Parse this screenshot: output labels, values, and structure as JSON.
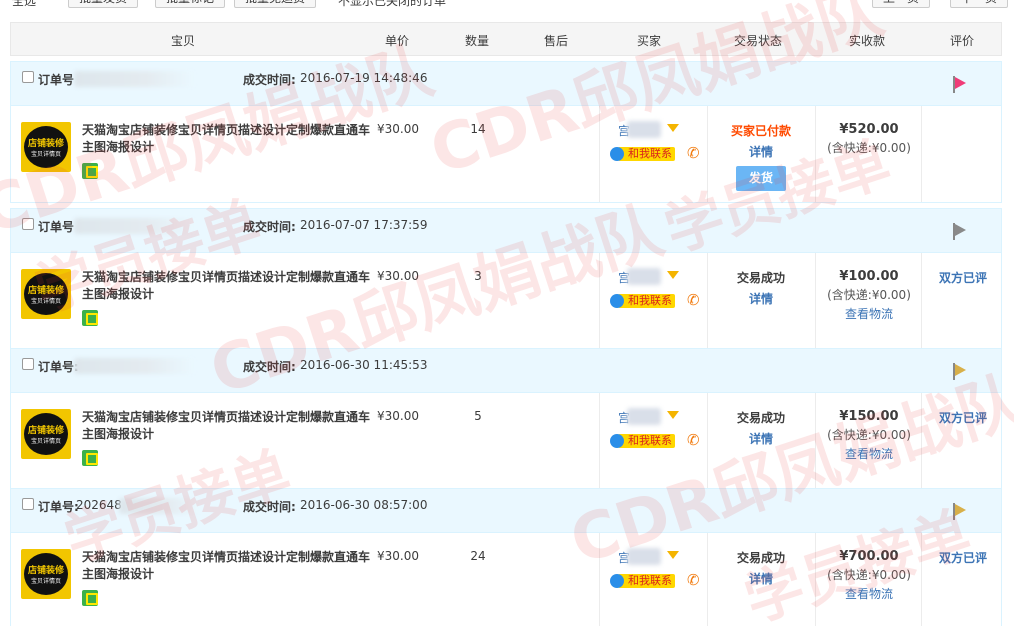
{
  "toolbar": {
    "select_all": "全选",
    "btn1": "批量发货",
    "btn2": "批量标记",
    "btn3": "批量免运费",
    "hide_closed": "不显示已关闭的订单",
    "prev": "上一页",
    "next": "下一页"
  },
  "columns": [
    "宝贝",
    "单价",
    "数量",
    "售后",
    "买家",
    "交易状态",
    "实收款",
    "评价"
  ],
  "orders": [
    {
      "order_label": "订单号",
      "order_no": "",
      "time_label": "成交时间:",
      "time": "2016-07-19 14:48:46",
      "flag_color": "#f03c78",
      "item_title": "天猫淘宝店铺装修宝贝详情页描述设计定制爆款直通车主图海报设计",
      "thumb_line1": "店铺装修",
      "thumb_line2": "宝贝详情页",
      "price": "¥30.00",
      "qty": "14",
      "buyer_name": "宫",
      "contact": "和我联系",
      "status": "买家已付款",
      "detail": "详情",
      "ship_btn": "发货",
      "amount": "¥520.00",
      "ship_fee": "(含快递:¥0.00)",
      "logistics": "",
      "review": ""
    },
    {
      "order_label": "订单号",
      "order_no": "",
      "time_label": "成交时间:",
      "time": "2016-07-07 17:37:59",
      "flag_color": "#8a8a8a",
      "item_title": "天猫淘宝店铺装修宝贝详情页描述设计定制爆款直通车主图海报设计",
      "thumb_line1": "店铺装修",
      "thumb_line2": "宝贝详情页",
      "price": "¥30.00",
      "qty": "3",
      "buyer_name": "宫",
      "contact": "和我联系",
      "status": "交易成功",
      "detail": "详情",
      "ship_btn": "",
      "amount": "¥100.00",
      "ship_fee": "(含快递:¥0.00)",
      "logistics": "查看物流",
      "review": "双方已评"
    },
    {
      "order_label": "订单号:",
      "order_no": "",
      "time_label": "成交时间:",
      "time": "2016-06-30 11:45:53",
      "flag_color": "#d8b04a",
      "item_title": "天猫淘宝店铺装修宝贝详情页描述设计定制爆款直通车主图海报设计",
      "thumb_line1": "店铺装修",
      "thumb_line2": "宝贝详情页",
      "price": "¥30.00",
      "qty": "5",
      "buyer_name": "宫",
      "contact": "和我联系",
      "status": "交易成功",
      "detail": "详情",
      "ship_btn": "",
      "amount": "¥150.00",
      "ship_fee": "(含快递:¥0.00)",
      "logistics": "查看物流",
      "review": "双方已评"
    },
    {
      "order_label": "订单号:",
      "order_no": "202648",
      "time_label": "成交时间:",
      "time": "2016-06-30 08:57:00",
      "flag_color": "#d8b04a",
      "item_title": "天猫淘宝店铺装修宝贝详情页描述设计定制爆款直通车主图海报设计",
      "thumb_line1": "店铺装修",
      "thumb_line2": "宝贝详情页",
      "price": "¥30.00",
      "qty": "24",
      "buyer_name": "宫",
      "contact": "和我联系",
      "status": "交易成功",
      "detail": "详情",
      "ship_btn": "",
      "amount": "¥700.00",
      "ship_fee": "(含快递:¥0.00)",
      "logistics": "查看物流",
      "review": "双方已评"
    }
  ],
  "watermarks": [
    "CDR邱凤娟战队",
    "学员接单"
  ]
}
